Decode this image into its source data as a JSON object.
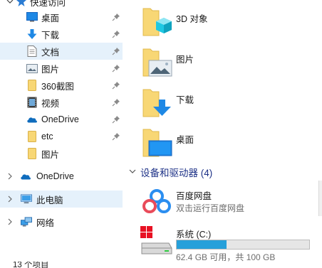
{
  "quick_access": {
    "label": "快速访问",
    "items": [
      {
        "label": "桌面",
        "icon": "desktop-icon",
        "pinned": true
      },
      {
        "label": "下载",
        "icon": "download-arrow-icon",
        "pinned": true
      },
      {
        "label": "文档",
        "icon": "document-icon",
        "pinned": true,
        "selected": true
      },
      {
        "label": "图片",
        "icon": "pictures-icon",
        "pinned": true
      },
      {
        "label": "360截图",
        "icon": "folder-icon",
        "pinned": true
      },
      {
        "label": "视频",
        "icon": "video-icon",
        "pinned": true
      },
      {
        "label": "OneDrive",
        "icon": "onedrive-cloud-icon",
        "pinned": true
      },
      {
        "label": "etc",
        "icon": "folder-icon",
        "pinned": true
      },
      {
        "label": "图片",
        "icon": "folder-icon",
        "pinned": false
      }
    ]
  },
  "tree": {
    "onedrive": "OneDrive",
    "this_pc": "此电脑",
    "network": "网络"
  },
  "content": {
    "folders": [
      {
        "name": "3D 对象",
        "icon": "3d-objects-folder-icon"
      },
      {
        "name": "图片",
        "icon": "pictures-folder-icon"
      },
      {
        "name": "下载",
        "icon": "downloads-folder-icon"
      },
      {
        "name": "桌面",
        "icon": "desktop-folder-icon"
      }
    ],
    "devices_section_title": "设备和驱动器 (4)",
    "devices": [
      {
        "name": "百度网盘",
        "subtitle": "双击运行百度网盘",
        "icon": "baidu-netdisk-icon"
      },
      {
        "name": "系统 (C:)",
        "free_text": "62.4 GB 可用，共 100 GB",
        "used_fraction": 0.376,
        "icon": "system-drive-icon"
      }
    ]
  },
  "status": {
    "item_count": "13 个项目"
  },
  "colors": {
    "selected_bg": "#e5f1fb",
    "section_title": "#1e3287",
    "drive_fill": "#26a0da",
    "folder_yellow": "#f8d775"
  }
}
